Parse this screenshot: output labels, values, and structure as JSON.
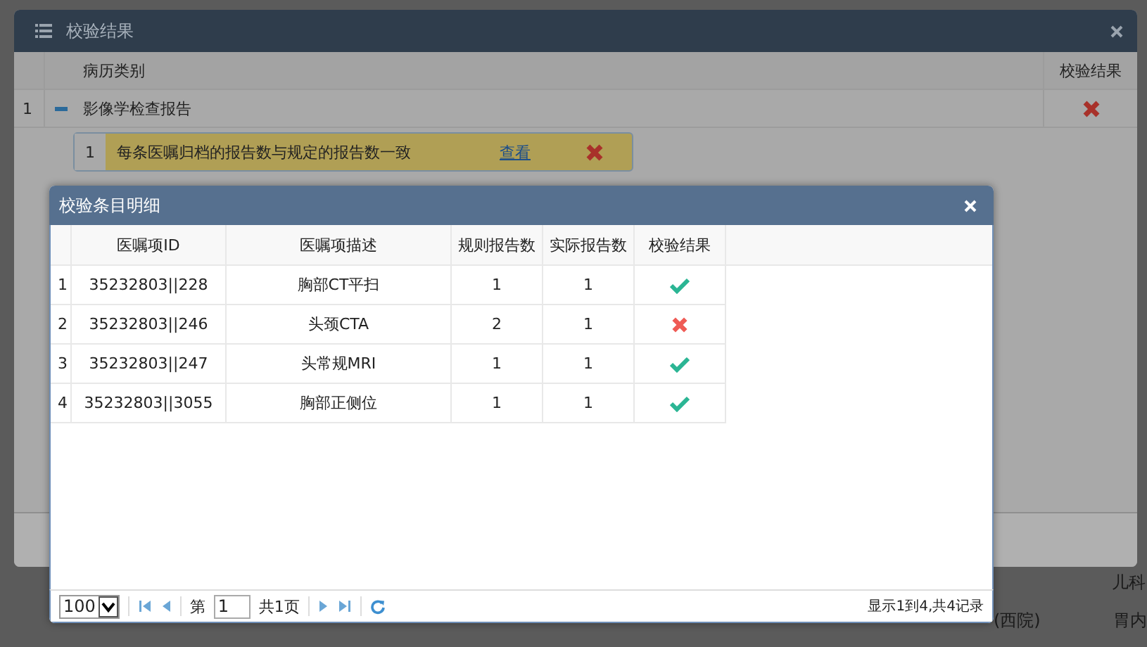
{
  "background": {
    "texts": [
      {
        "text": "儿科"
      },
      {
        "text": "(西院)"
      },
      {
        "text": "胃内"
      }
    ]
  },
  "outer_dialog": {
    "title": "校验结果",
    "columns": [
      "病历类别",
      "校验结果"
    ],
    "rows": [
      {
        "index": "1",
        "expanded": true,
        "category": "影像学检查报告",
        "passed": false,
        "children": [
          {
            "index": "1",
            "rule": "每条医嘱归档的报告数与规定的报告数一致",
            "link": "查看",
            "passed": false
          }
        ]
      }
    ]
  },
  "detail_dialog": {
    "title": "校验条目明细",
    "columns": [
      "医嘱项ID",
      "医嘱项描述",
      "规则报告数",
      "实际报告数",
      "校验结果"
    ],
    "rows": [
      {
        "index": "1",
        "id": "35232803||228",
        "desc": "胸部CT平扫",
        "rule_count": "1",
        "actual_count": "1",
        "passed": true
      },
      {
        "index": "2",
        "id": "35232803||246",
        "desc": "头颈CTA",
        "rule_count": "2",
        "actual_count": "1",
        "passed": false
      },
      {
        "index": "3",
        "id": "35232803||247",
        "desc": "头常规MRI",
        "rule_count": "1",
        "actual_count": "1",
        "passed": true
      },
      {
        "index": "4",
        "id": "35232803||3055",
        "desc": "胸部正侧位",
        "rule_count": "1",
        "actual_count": "1",
        "passed": true
      }
    ],
    "pager": {
      "page_size": "100",
      "page_label": "第",
      "page": "1",
      "total_pages": "共1页",
      "summary": "显示1到4,共4记录"
    }
  }
}
